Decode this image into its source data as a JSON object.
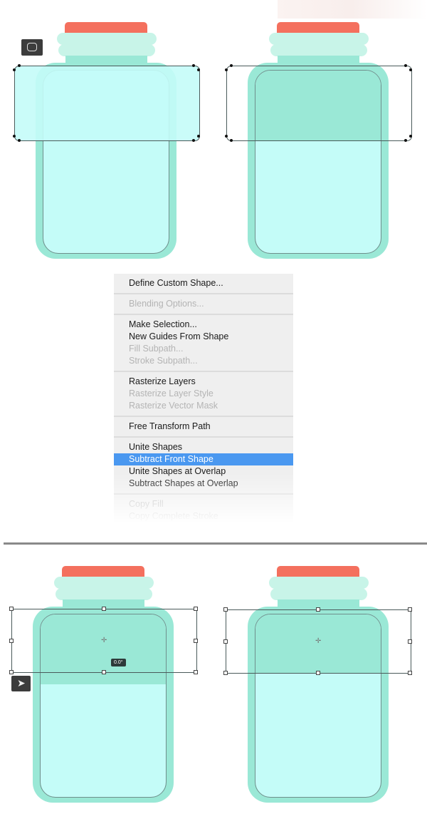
{
  "colors": {
    "cap": "#f4705e",
    "rim": "#c8f4e8",
    "jar": "#9ae8d6",
    "liquid": "#c4fcf8",
    "highlight": "#4a98f0"
  },
  "icons": {
    "top_tool": "rounded-rectangle-tool-icon",
    "bottom_tool": "path-selection-arrow-icon"
  },
  "menu": {
    "groups": [
      [
        {
          "label": "Define Custom Shape...",
          "enabled": true
        }
      ],
      [
        {
          "label": "Blending Options...",
          "enabled": false
        }
      ],
      [
        {
          "label": "Make Selection...",
          "enabled": true
        },
        {
          "label": "New Guides From Shape",
          "enabled": true
        },
        {
          "label": "Fill Subpath...",
          "enabled": false
        },
        {
          "label": "Stroke Subpath...",
          "enabled": false
        }
      ],
      [
        {
          "label": "Rasterize Layers",
          "enabled": true
        },
        {
          "label": "Rasterize Layer Style",
          "enabled": false
        },
        {
          "label": "Rasterize Vector Mask",
          "enabled": false
        }
      ],
      [
        {
          "label": "Free Transform Path",
          "enabled": true
        }
      ],
      [
        {
          "label": "Unite Shapes",
          "enabled": true
        },
        {
          "label": "Subtract Front Shape",
          "enabled": true,
          "highlighted": true
        },
        {
          "label": "Unite Shapes at Overlap",
          "enabled": true
        },
        {
          "label": "Subtract Shapes at Overlap",
          "enabled": true
        }
      ],
      [
        {
          "label": "Copy Fill",
          "enabled": false
        },
        {
          "label": "Copy Complete Stroke",
          "enabled": false
        }
      ]
    ]
  },
  "rotation_readout": "0.0°"
}
